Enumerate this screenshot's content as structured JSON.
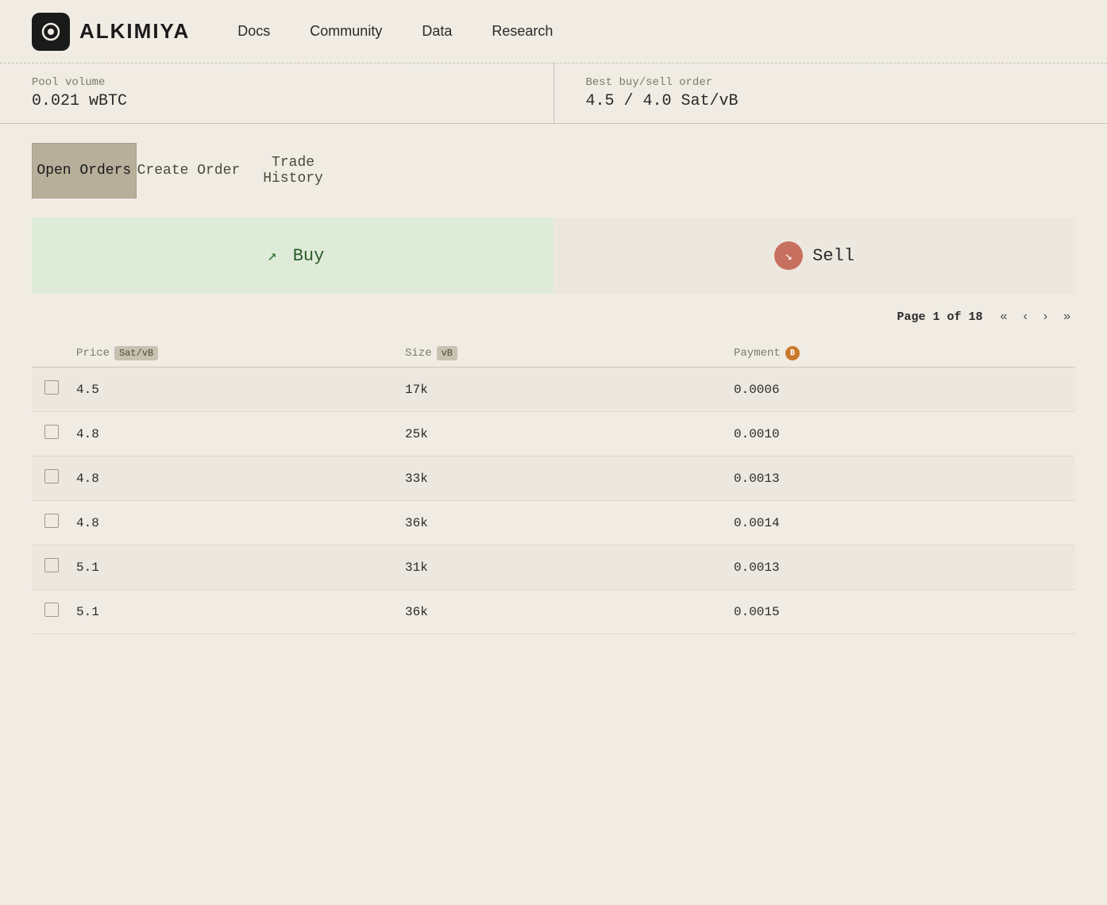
{
  "header": {
    "logo_text": "ALKIMIYA",
    "nav": {
      "docs": "Docs",
      "community": "Community",
      "data": "Data",
      "research": "Research"
    }
  },
  "stats": {
    "pool_volume_label": "Pool volume",
    "pool_volume_value": "0.021 wBTC",
    "best_order_label": "Best buy/sell order",
    "best_order_value": "4.5 / 4.0 Sat/vB"
  },
  "tabs": {
    "open_orders": "Open Orders",
    "create_order": "Create Order",
    "trade_history": "Trade History"
  },
  "trade_panel": {
    "buy_label": "Buy",
    "sell_label": "Sell"
  },
  "pagination": {
    "page_info": "Page 1 of 18"
  },
  "table": {
    "headers": {
      "price": "Price",
      "price_unit": "Sat/vB",
      "size": "Size",
      "size_unit": "vB",
      "payment": "Payment"
    },
    "rows": [
      {
        "price": "4.5",
        "size": "17k",
        "payment": "0.0006"
      },
      {
        "price": "4.8",
        "size": "25k",
        "payment": "0.0010"
      },
      {
        "price": "4.8",
        "size": "33k",
        "payment": "0.0013"
      },
      {
        "price": "4.8",
        "size": "36k",
        "payment": "0.0014"
      },
      {
        "price": "5.1",
        "size": "31k",
        "payment": "0.0013"
      },
      {
        "price": "5.1",
        "size": "36k",
        "payment": "0.0015"
      }
    ]
  }
}
